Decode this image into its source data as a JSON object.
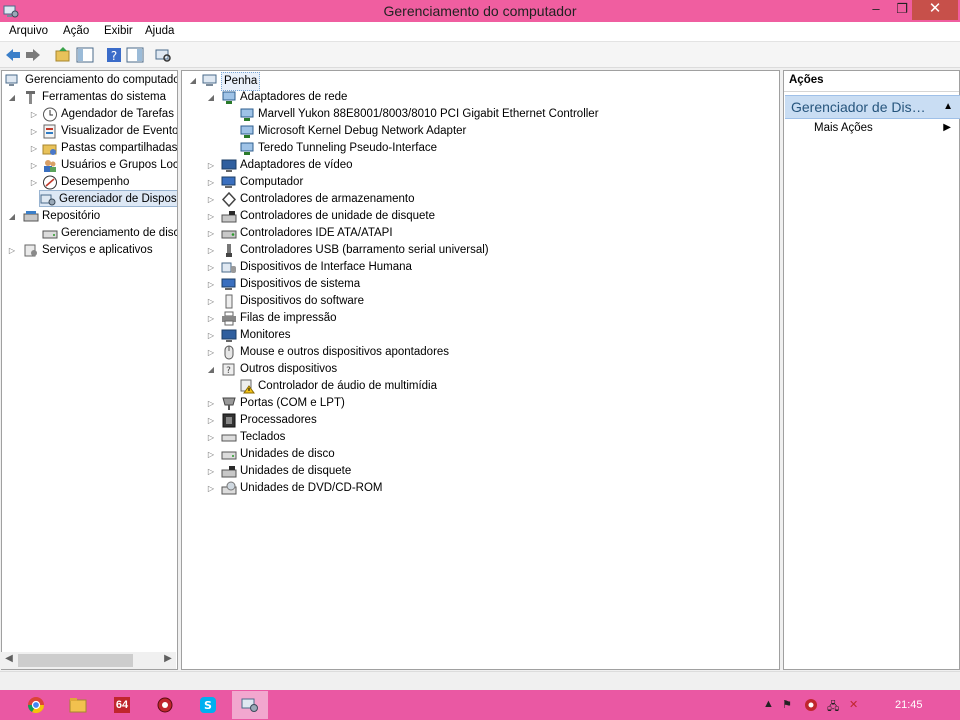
{
  "window": {
    "title": "Gerenciamento do computador",
    "min_label": "–",
    "restore_label": "❐",
    "close_label": "✕"
  },
  "menu": [
    "Arquivo",
    "Ação",
    "Exibir",
    "Ajuda"
  ],
  "toolbar": {
    "icons": [
      "back-icon",
      "forward-icon",
      "up-folder-icon",
      "show-hide-console-tree-icon",
      "help-icon",
      "show-hide-action-pane-icon",
      "scan-hardware-icon"
    ]
  },
  "left_tree": {
    "root": "Gerenciamento do computador (Local)",
    "system_tools": "Ferramentas do sistema",
    "items": [
      "Agendador de Tarefas",
      "Visualizador de Eventos",
      "Pastas compartilhadas",
      "Usuários e Grupos Locais",
      "Desempenho",
      "Gerenciador de Dispositivos"
    ],
    "storage": "Repositório",
    "disk_mgmt": "Gerenciamento de disco",
    "services": "Serviços e aplicativos"
  },
  "device_tree": {
    "computer": "Penha",
    "network": "Adaptadores de rede",
    "network_children": [
      "Marvell Yukon 88E8001/8003/8010 PCI Gigabit Ethernet Controller",
      "Microsoft Kernel Debug Network Adapter",
      "Teredo Tunneling Pseudo-Interface"
    ],
    "categories_a": [
      "Adaptadores de vídeo",
      "Computador",
      "Controladores de armazenamento",
      "Controladores de unidade de disquete",
      "Controladores IDE ATA/ATAPI",
      "Controladores USB (barramento serial universal)",
      "Dispositivos de Interface Humana",
      "Dispositivos de sistema",
      "Dispositivos do software",
      "Filas de impressão",
      "Monitores",
      "Mouse e outros dispositivos apontadores"
    ],
    "other": "Outros dispositivos",
    "other_children": [
      "Controlador de áudio de multimídia"
    ],
    "categories_b": [
      "Portas (COM e LPT)",
      "Processadores",
      "Teclados",
      "Unidades de disco",
      "Unidades de disquete",
      "Unidades de DVD/CD-ROM"
    ]
  },
  "actions": {
    "header": "Ações",
    "section": "Gerenciador de Dispositivos",
    "more": "Mais Ações"
  },
  "taskbar": {
    "apps": [
      "chrome-icon",
      "file-explorer-icon",
      "64-app-icon",
      "red-gear-app-icon",
      "skype-icon",
      "computer-management-icon"
    ],
    "app64_label": "64",
    "clock": "21:45"
  }
}
